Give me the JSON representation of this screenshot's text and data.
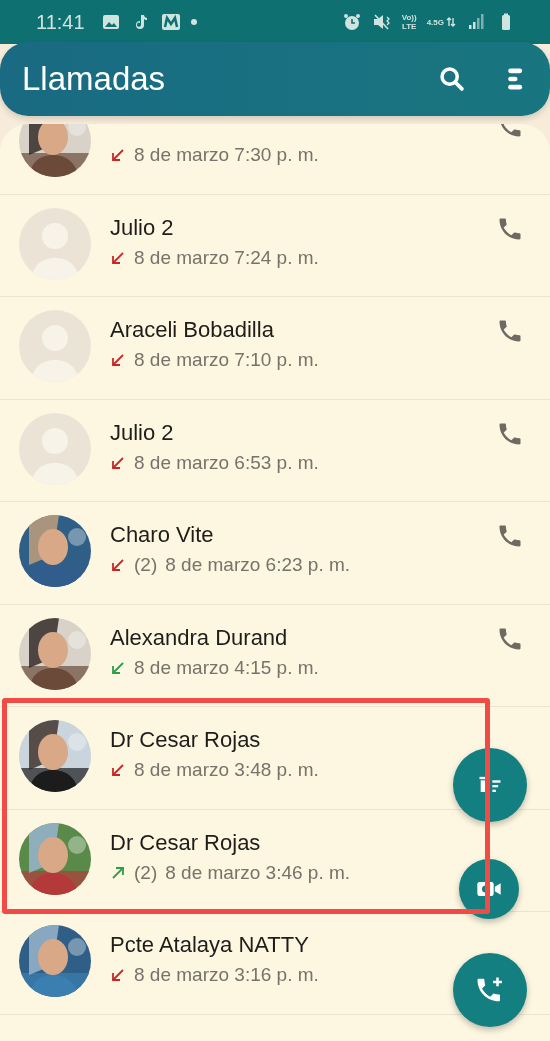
{
  "status_bar": {
    "time": "11:41",
    "network_texts": [
      "Vo))",
      "LTE",
      "4.5G"
    ]
  },
  "header": {
    "title": "Llamadas"
  },
  "calls": [
    {
      "kind": "missed",
      "time": "8 de marzo 7:30 p. m.",
      "highlighted": false,
      "phone_visible": true
    },
    {
      "name": "Julio 2",
      "avatar": {
        "kind": "default"
      },
      "kind": "missed",
      "time": "8 de marzo 7:24 p. m.",
      "highlighted": false,
      "phone_visible": true
    },
    {
      "name": "Araceli Bobadilla",
      "avatar": {
        "kind": "default"
      },
      "kind": "missed",
      "time": "8 de marzo 7:10 p. m.",
      "highlighted": false,
      "phone_visible": true
    },
    {
      "name": "Julio 2",
      "avatar": {
        "kind": "default"
      },
      "kind": "missed",
      "time": "8 de marzo 6:53 p. m.",
      "highlighted": false,
      "phone_visible": true
    },
    {
      "name": "Charo Vite",
      "kind": "missed",
      "count": "(2)",
      "time": "8 de marzo 6:23 p. m.",
      "highlighted": false,
      "phone_visible": true
    },
    {
      "name": "Alexandra Durand",
      "kind": "incoming",
      "time": "8 de marzo 4:15 p. m.",
      "highlighted": false,
      "phone_visible": true
    },
    {
      "name": "Dr Cesar Rojas",
      "kind": "missed",
      "time": "8 de marzo 3:48 p. m.",
      "highlighted": true
    },
    {
      "name": "Dr Cesar Rojas",
      "kind": "outgoing",
      "count": "(2)",
      "time": "8 de marzo 3:46 p. m.",
      "highlighted": true
    },
    {
      "name": "Pcte Atalaya NATTY",
      "kind": "missed",
      "time": "8 de marzo 3:16 p. m.",
      "highlighted": false
    }
  ]
}
